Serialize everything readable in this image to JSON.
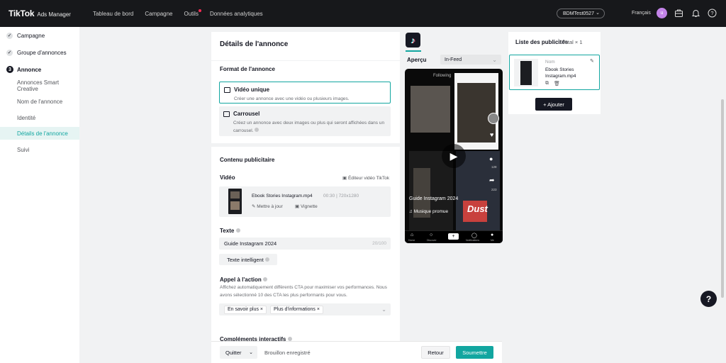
{
  "header": {
    "logo": "TikTok",
    "logo_suffix": "Ads Manager",
    "nav": [
      "Tableau de bord",
      "Campagne",
      "Outils",
      "Données analytiques"
    ],
    "account": "BDMTest0527",
    "language": "Français",
    "avatar_letter": "u"
  },
  "sidebar": {
    "items": [
      {
        "label": "Campagne"
      },
      {
        "label": "Groupe d'annonces"
      },
      {
        "label": "Annonce",
        "num": "3"
      },
      {
        "label": "Annonces Smart Creative"
      },
      {
        "label": "Nom de l'annonce"
      },
      {
        "label": "Identité"
      },
      {
        "label": "Détails de l'annonce"
      },
      {
        "label": "Suivi"
      }
    ]
  },
  "details": {
    "title": "Détails de l'annonce",
    "format_title": "Format de l'annonce",
    "single_video": {
      "name": "Vidéo unique",
      "desc": "Créer une annonce avec une vidéo ou plusieurs images."
    },
    "carousel": {
      "name": "Carrousel",
      "desc": "Créez un annonce avec deux images ou plus qui seront affichées dans un carrousel."
    },
    "content_title": "Contenu publicitaire",
    "video_label": "Vidéo",
    "video_editor": "Éditeur vidéo TikTok",
    "video_file": "Ebook Stories Instagram.mp4",
    "video_meta": "00:30  |  720x1280",
    "update": "Mettre à jour",
    "thumbnail": "Vignette",
    "text_label": "Texte",
    "text_value": "Guide Instagram 2024",
    "text_count": "20/100",
    "smart_text": "Texte intelligent",
    "cta_label": "Appel à l'action",
    "cta_desc": "Affichez automatiquement différents CTA pour maximiser vos performances. Nous avons sélectionné 10 des CTA les plus performants pour vous.",
    "cta_chips": [
      "En savoir plus",
      "Plus d'informations"
    ],
    "interactive_label": "Compléments interactifs"
  },
  "preview": {
    "label": "Aperçu",
    "placement": "In-Feed",
    "following": "Following",
    "caption": "Guide Instagram 2024",
    "music": "Musique promue",
    "overlay_text": "Dust",
    "likes": "128",
    "shares": "223",
    "tabs": [
      "Home",
      "Discover",
      "Notifications",
      "Me"
    ]
  },
  "ad_list": {
    "title": "Liste des publicités",
    "total": "Total × 1",
    "item_label": "Nom",
    "item_name": "Ebook Stories Instagram.mp4",
    "add": "+ Ajouter"
  },
  "footer": {
    "quit": "Quitter",
    "draft": "Brouillon enregistré",
    "back": "Retour",
    "submit": "Soumettre"
  },
  "colors": {
    "accent": "#12a6a0",
    "topbar": "#17181b",
    "avatar": "#c384e8"
  }
}
